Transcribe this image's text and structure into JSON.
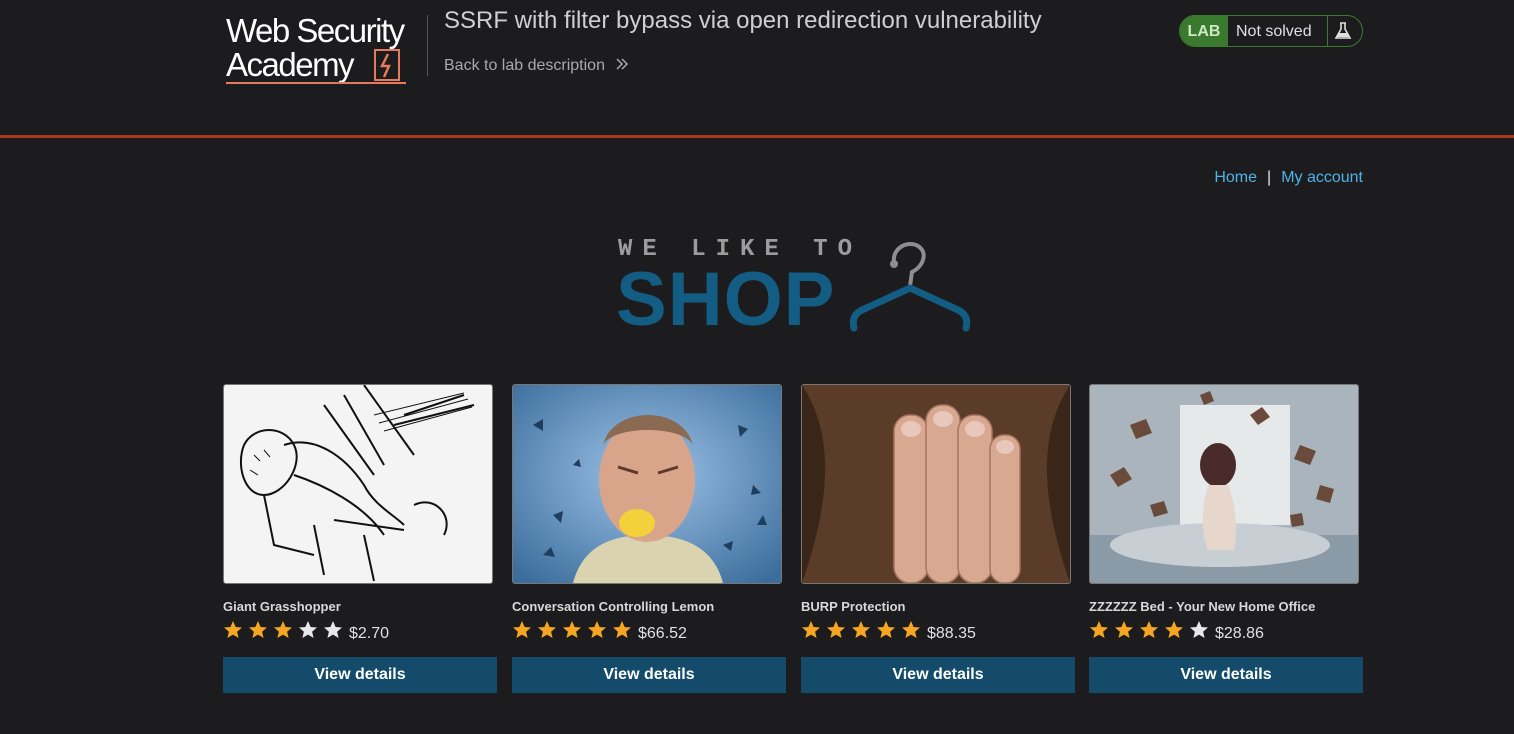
{
  "header": {
    "logo_line1": "Web Security",
    "logo_line2": "Academy",
    "lab_title": "SSRF with filter bypass via open redirection vulnerability",
    "back_link": "Back to lab description",
    "back_icon": "double-chevron-right-icon",
    "lab_badge": "LAB",
    "lab_status": "Not solved",
    "colors": {
      "accent_rule": "#a8391a",
      "lab_green": "#3a7a2e"
    }
  },
  "nav": {
    "home": "Home",
    "separator": "|",
    "account": "My account"
  },
  "banner": {
    "small": "WE LIKE TO",
    "big": "SHOP",
    "icon": "clothes-hanger-icon"
  },
  "products": [
    {
      "name": "Giant Grasshopper",
      "rating": 3,
      "price": "$2.70",
      "button": "View details",
      "image": "grasshopper-sketch"
    },
    {
      "name": "Conversation Controlling Lemon",
      "rating": 5,
      "price": "$66.52",
      "button": "View details",
      "image": "man-biting-lemon"
    },
    {
      "name": "BURP Protection",
      "rating": 5,
      "price": "$88.35",
      "button": "View details",
      "image": "hand-over-mouth"
    },
    {
      "name": "ZZZZZZ Bed - Your New Home Office",
      "rating": 4,
      "price": "$28.86",
      "button": "View details",
      "image": "woman-bed-flying-books"
    }
  ]
}
